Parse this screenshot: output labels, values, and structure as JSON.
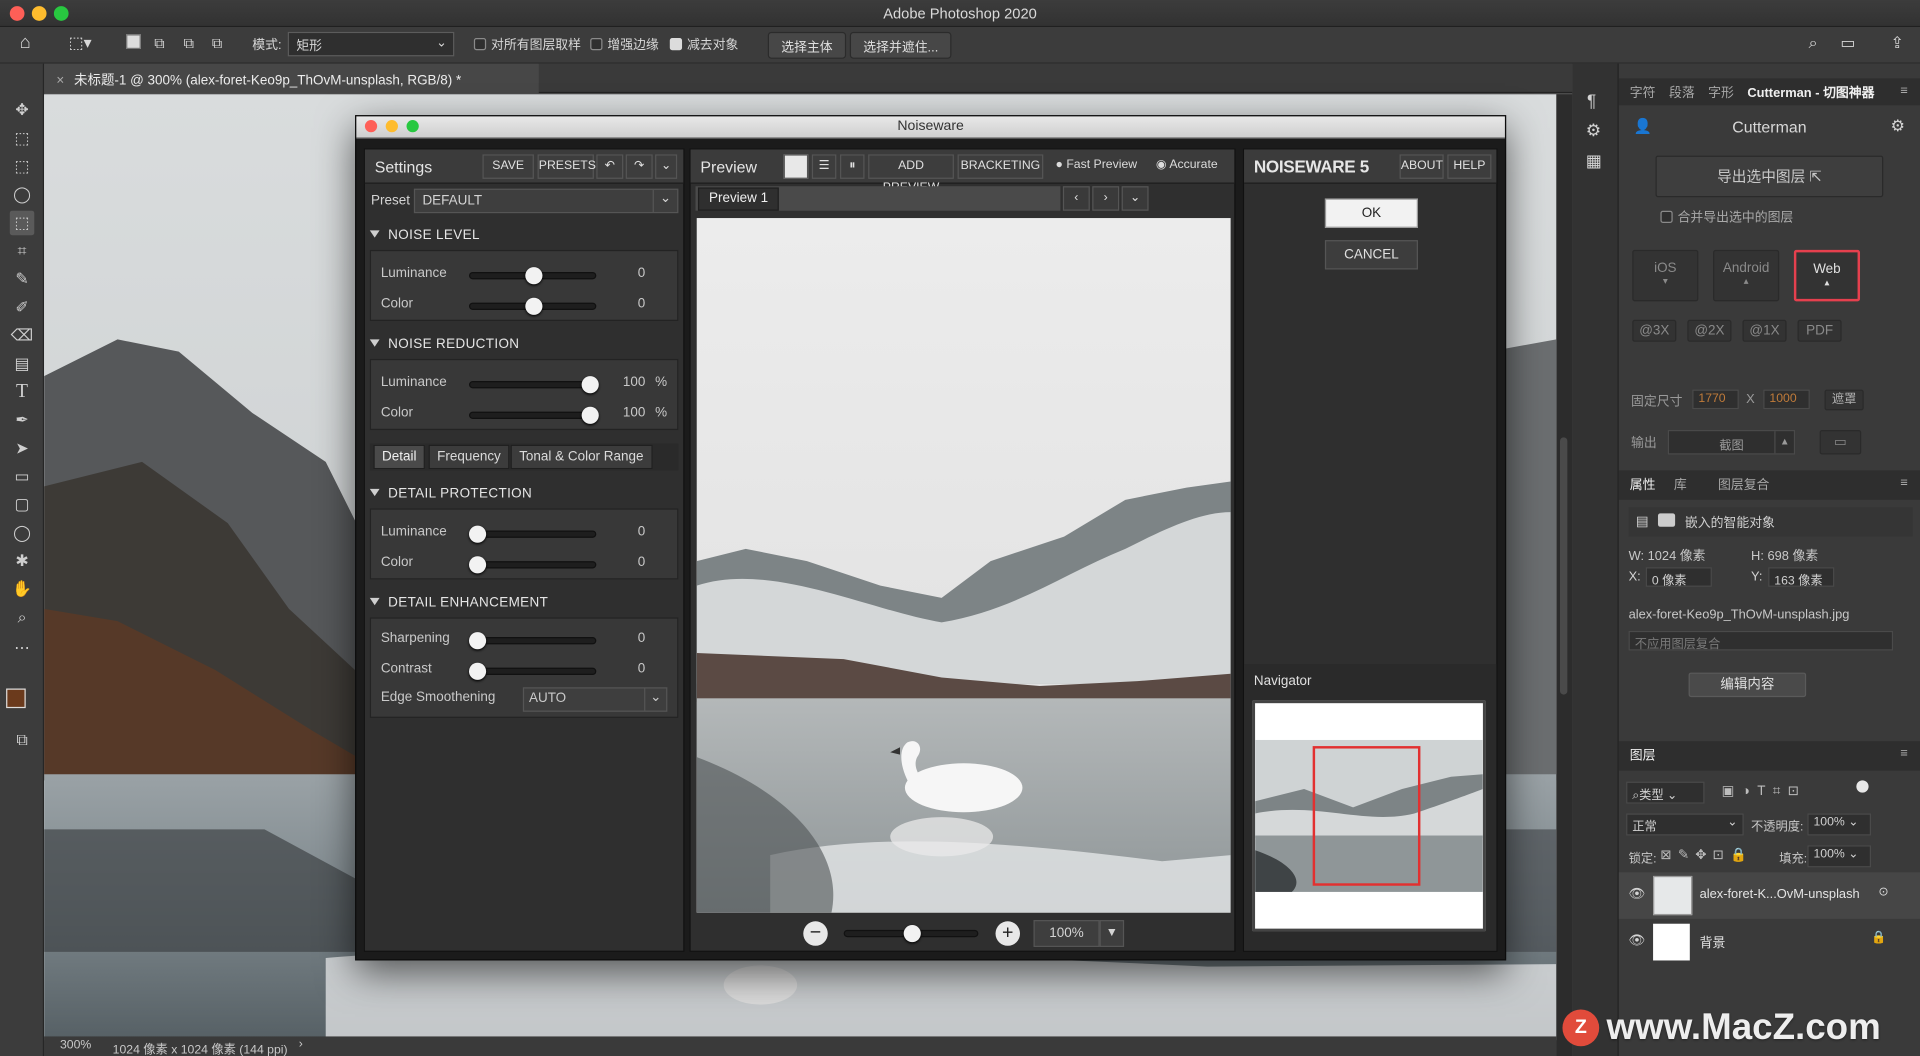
{
  "app": {
    "window_title": "Adobe Photoshop 2020"
  },
  "options_bar": {
    "mode_label": "模式:",
    "mode_value": "矩形",
    "cb_sample_all": "对所有图层取样",
    "cb_enhance_edge": "增强边缘",
    "cb_subtract": "减去对象",
    "btn_select_subject": "选择主体",
    "btn_select_mask": "选择并遮住..."
  },
  "document": {
    "tab_title": "未标题-1 @ 300% (alex-foret-Keo9p_ThOvM-unsplash, RGB/8) *"
  },
  "status": {
    "zoom": "300%",
    "info": "1024 像素 x 1024 像素 (144 ppi)"
  },
  "noiseware": {
    "title": "Noiseware",
    "settings": {
      "title": "Settings",
      "save": "SAVE",
      "presets": "PRESETS",
      "preset_label": "Preset",
      "preset_value": "DEFAULT",
      "noise_level": {
        "title": "NOISE LEVEL",
        "luminance_label": "Luminance",
        "luminance": "0",
        "color_label": "Color",
        "color": "0"
      },
      "noise_reduction": {
        "title": "NOISE REDUCTION",
        "luminance_label": "Luminance",
        "luminance": "100",
        "color_label": "Color",
        "color": "100",
        "unit": "%"
      },
      "tabs": [
        "Detail",
        "Frequency",
        "Tonal & Color Range"
      ],
      "detail_protection": {
        "title": "DETAIL PROTECTION",
        "luminance_label": "Luminance",
        "luminance": "0",
        "color_label": "Color",
        "color": "0"
      },
      "detail_enhancement": {
        "title": "DETAIL ENHANCEMENT",
        "sharpening_label": "Sharpening",
        "sharpening": "0",
        "contrast_label": "Contrast",
        "contrast": "0",
        "edge_label": "Edge Smoothening",
        "edge_value": "AUTO"
      },
      "slider_levels": {
        "nl_luminance": 0.5,
        "nl_color": 0.5,
        "nr_luminance": 1.0,
        "nr_color": 1.0,
        "dp_luminance": 0.0,
        "dp_color": 0.0,
        "de_sharpening": 0.0,
        "de_contrast": 0.0
      }
    },
    "preview": {
      "title": "Preview",
      "add_preview": "ADD PREVIEW",
      "bracketing": "BRACKETING",
      "fast_preview": "Fast Preview",
      "accurate": "Accurate",
      "tab": "Preview 1",
      "zoom": "100%",
      "zoom_level": 0.5
    },
    "brand": {
      "name": "NOISEWARE",
      "version": "5",
      "about": "ABOUT",
      "help": "HELP",
      "ok": "OK",
      "cancel": "CANCEL",
      "navigator": "Navigator"
    }
  },
  "cutterman": {
    "tabs": [
      "字符",
      "段落",
      "字形",
      "Cutterman - 切图神器"
    ],
    "title": "Cutterman",
    "export_btn": "导出选中图层",
    "merge_label": "合并导出选中的图层",
    "platforms": [
      "iOS",
      "Android",
      "Web"
    ],
    "scales": [
      "@3X",
      "@2X",
      "@1X",
      "PDF"
    ],
    "fixed_size_label": "固定尺寸",
    "width": "1770",
    "x": "X",
    "height": "1000",
    "mask_btn": "遮罩",
    "output_label": "输出",
    "output_value": "截图"
  },
  "properties": {
    "tabs": [
      "属性",
      "库",
      "图层复合"
    ],
    "type": "嵌入的智能对象",
    "w": "W: 1024 像素",
    "h": "H: 698 像素",
    "x_label": "X:",
    "x": "0 像素",
    "y_label": "Y:",
    "y": "163 像素",
    "filename": "alex-foret-Keo9p_ThOvM-unsplash.jpg",
    "comp": "不应用图层复合",
    "edit_btn": "编辑内容"
  },
  "layers": {
    "title": "图层",
    "filter": "类型",
    "blend": "正常",
    "opacity_label": "不透明度:",
    "opacity": "100%",
    "lock_label": "锁定:",
    "fill_label": "填充:",
    "fill": "100%",
    "items": [
      {
        "name": "alex-foret-K...OvM-unsplash"
      },
      {
        "name": "背景"
      }
    ]
  },
  "watermark": {
    "text": "www.MacZ.com"
  }
}
